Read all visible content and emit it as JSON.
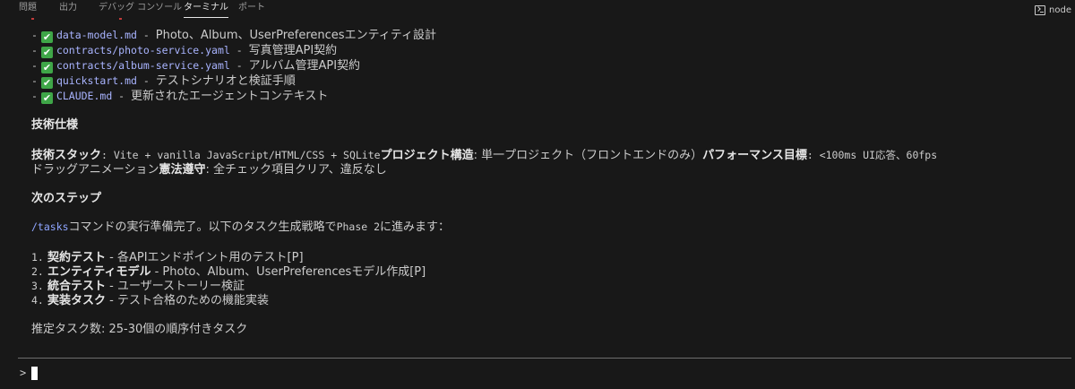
{
  "tabs": [
    {
      "label": "問題",
      "active": false
    },
    {
      "label": "出力",
      "active": false
    },
    {
      "label": "デバッグ コンソール",
      "active": false
    },
    {
      "label": "ターミナル",
      "active": true
    },
    {
      "label": "ポート",
      "active": false
    }
  ],
  "terminal_instance": {
    "label": "node",
    "icon": "terminal-icon"
  },
  "files": [
    {
      "name": "data-model.md",
      "desc": "Photo、Album、UserPreferencesエンティティ設計"
    },
    {
      "name": "contracts/photo-service.yaml",
      "desc": "写真管理API契約"
    },
    {
      "name": "contracts/album-service.yaml",
      "desc": "アルバム管理API契約"
    },
    {
      "name": "quickstart.md",
      "desc": "テストシナリオと検証手順"
    },
    {
      "name": "CLAUDE.md",
      "desc": "更新されたエージェントコンテキスト"
    }
  ],
  "tech_heading": "技術仕様",
  "tech": {
    "stack_label": "技術スタック",
    "stack_value": ": Vite + vanilla JavaScript/HTML/CSS + SQLite",
    "structure_label": "プロジェクト構造",
    "structure_value": ": 単一プロジェクト（フロントエンドのみ）",
    "perf_label": "パフォーマンス目標",
    "perf_value": ": <100ms UI応答、60fps",
    "perf_cont": "ドラッグアニメーション",
    "const_label": "憲法遵守",
    "const_value": ": 全チェック項目クリア、違反なし"
  },
  "next_heading": "次のステップ",
  "next_intro": {
    "command": "/tasks",
    "text1": "コマンドの実行準備完了。以下のタスク生成戦略で",
    "phase": "Phase 2",
    "text2": "に進みます："
  },
  "steps": [
    {
      "num": "1.",
      "title": "契約テスト",
      "desc": " - 各APIエンドポイント用のテスト[P]"
    },
    {
      "num": "2.",
      "title": "エンティティモデル",
      "desc": " - Photo、Album、UserPreferencesモデル作成[P]"
    },
    {
      "num": "3.",
      "title": "統合テスト",
      "desc": " - ユーザーストーリー検証"
    },
    {
      "num": "4.",
      "title": "実装タスク",
      "desc": " - テスト合格のための機能実装"
    }
  ],
  "estimate": "推定タスク数: 25-30個の順序付きタスク",
  "prompt_symbol": ">",
  "dash": "-",
  "check_glyph": "✔",
  "colors": {
    "background": "#181818",
    "file_link": "#a9b4ff",
    "check_green": "#3fa648"
  }
}
